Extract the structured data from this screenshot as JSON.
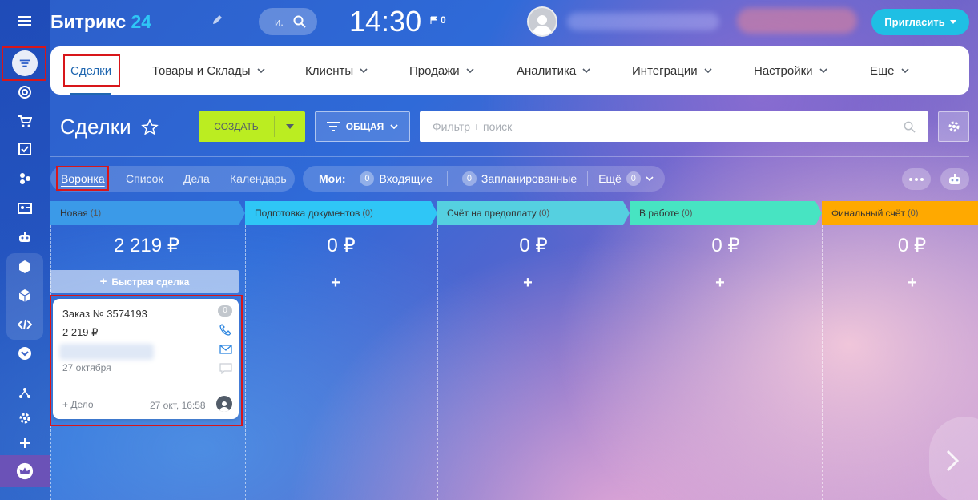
{
  "app": {
    "logo_main": "Битрикс",
    "logo_num": "24"
  },
  "top": {
    "search_placeholder": "и.",
    "clock": "14:30",
    "flag_count": "0",
    "invite_label": "Пригласить"
  },
  "menu": {
    "items": [
      "Сделки",
      "Товары и Склады",
      "Клиенты",
      "Продажи",
      "Аналитика",
      "Интеграции",
      "Настройки",
      "Еще"
    ]
  },
  "toolbar": {
    "title": "Сделки",
    "create_label": "СОЗДАТЬ",
    "filter_label": "ОБЩАЯ",
    "search_placeholder": "Фильтр + поиск"
  },
  "views": {
    "tabs": [
      "Воронка",
      "Список",
      "Дела",
      "Календарь"
    ],
    "mine_label": "Мои:",
    "incoming_label": "Входящие",
    "incoming_count": "0",
    "planned_label": "Запланированные",
    "planned_count": "0",
    "more_label": "Ещё",
    "more_count": "0"
  },
  "stages": [
    {
      "name": "Новая",
      "count": "(1)",
      "sum": "2 219 ₽",
      "color": "#3b9ae8"
    },
    {
      "name": "Подготовка документов",
      "count": "(0)",
      "sum": "0 ₽",
      "color": "#2fc6f6"
    },
    {
      "name": "Счёт на предоплату",
      "count": "(0)",
      "sum": "0 ₽",
      "color": "#55d0e0"
    },
    {
      "name": "В работе",
      "count": "(0)",
      "sum": "0 ₽",
      "color": "#47e4c2"
    },
    {
      "name": "Финальный счёт",
      "count": "(0)",
      "sum": "0 ₽",
      "color": "#ffa900"
    }
  ],
  "quick_deal_label": "Быстрая сделка",
  "plus_sign": "+",
  "card": {
    "title": "Заказ № 3574193",
    "price": "2 219 ₽",
    "date": "27 октября",
    "counter": "0",
    "task_label": "+ Дело",
    "last_activity": "27 окт, 16:58"
  }
}
